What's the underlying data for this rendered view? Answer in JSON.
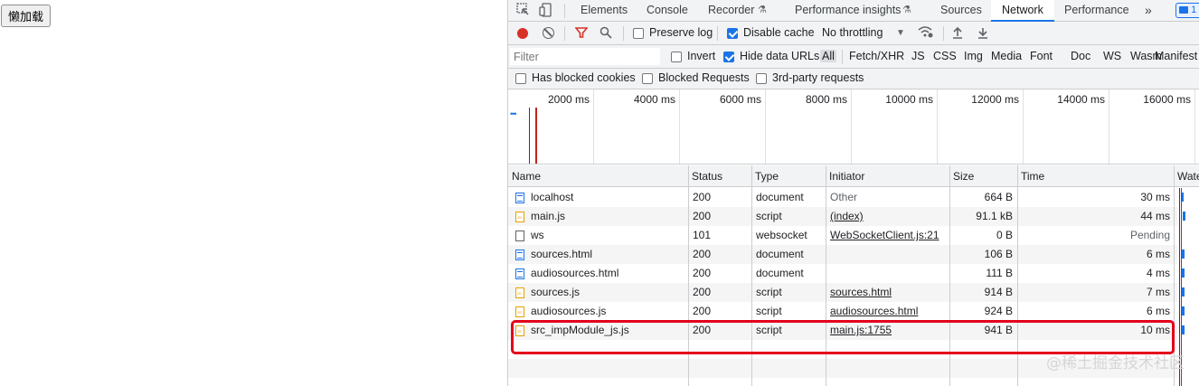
{
  "page": {
    "button_label": "懒加载"
  },
  "devtools": {
    "tabs": [
      {
        "label": "Elements",
        "active": false
      },
      {
        "label": "Console",
        "active": false
      },
      {
        "label": "Recorder",
        "active": false
      },
      {
        "label": "Performance insights",
        "active": false
      },
      {
        "label": "Sources",
        "active": false
      },
      {
        "label": "Network",
        "active": true
      },
      {
        "label": "Performance",
        "active": false
      }
    ],
    "more_tabs": "»",
    "issues_count": "1",
    "toolbar": {
      "preserve_log": {
        "label": "Preserve log",
        "checked": false
      },
      "disable_cache": {
        "label": "Disable cache",
        "checked": true
      },
      "throttling": "No throttling"
    },
    "filter": {
      "placeholder": "Filter",
      "invert": {
        "label": "Invert",
        "checked": false
      },
      "hide_data_urls": {
        "label": "Hide data URLs",
        "checked": true
      },
      "types": [
        "All",
        "Fetch/XHR",
        "JS",
        "CSS",
        "Img",
        "Media",
        "Font",
        "Doc",
        "WS",
        "Wasm",
        "Manifest"
      ],
      "active_type": "All"
    },
    "checks": {
      "has_blocked_cookies": {
        "label": "Has blocked cookies",
        "checked": false
      },
      "blocked_requests": {
        "label": "Blocked Requests",
        "checked": false
      },
      "third_party": {
        "label": "3rd-party requests",
        "checked": false
      }
    },
    "overview": {
      "ticks": [
        "2000 ms",
        "4000 ms",
        "6000 ms",
        "8000 ms",
        "10000 ms",
        "12000 ms",
        "14000 ms",
        "16000 ms"
      ]
    },
    "table": {
      "columns": [
        "Name",
        "Status",
        "Type",
        "Initiator",
        "Size",
        "Time",
        "Wate"
      ],
      "rows": [
        {
          "name": "localhost",
          "icon": "doc",
          "status": "200",
          "type": "document",
          "initiator": "Other",
          "initiator_link": false,
          "size": "664 B",
          "time": "30 ms"
        },
        {
          "name": "main.js",
          "icon": "js",
          "status": "200",
          "type": "script",
          "initiator": "(index)",
          "initiator_link": true,
          "size": "91.1 kB",
          "time": "44 ms"
        },
        {
          "name": "ws",
          "icon": "ws",
          "status": "101",
          "type": "websocket",
          "initiator": "WebSocketClient.js:21",
          "initiator_link": true,
          "size": "0 B",
          "time": "Pending"
        },
        {
          "name": "sources.html",
          "icon": "doc",
          "status": "200",
          "type": "document",
          "initiator": "",
          "initiator_link": false,
          "size": "106 B",
          "time": "6 ms"
        },
        {
          "name": "audiosources.html",
          "icon": "doc",
          "status": "200",
          "type": "document",
          "initiator": "",
          "initiator_link": false,
          "size": "111 B",
          "time": "4 ms"
        },
        {
          "name": "sources.js",
          "icon": "js",
          "status": "200",
          "type": "script",
          "initiator": "sources.html",
          "initiator_link": true,
          "size": "914 B",
          "time": "7 ms"
        },
        {
          "name": "audiosources.js",
          "icon": "js",
          "status": "200",
          "type": "script",
          "initiator": "audiosources.html",
          "initiator_link": true,
          "size": "924 B",
          "time": "6 ms"
        },
        {
          "name": "src_impModule_js.js",
          "icon": "js",
          "status": "200",
          "type": "script",
          "initiator": "main.js:1755",
          "initiator_link": true,
          "size": "941 B",
          "time": "10 ms"
        }
      ]
    }
  },
  "watermark": "@稀土掘金技术社区",
  "colors": {
    "accent": "#1a73e8",
    "record": "#d93025",
    "highlight": "#e3001b"
  }
}
